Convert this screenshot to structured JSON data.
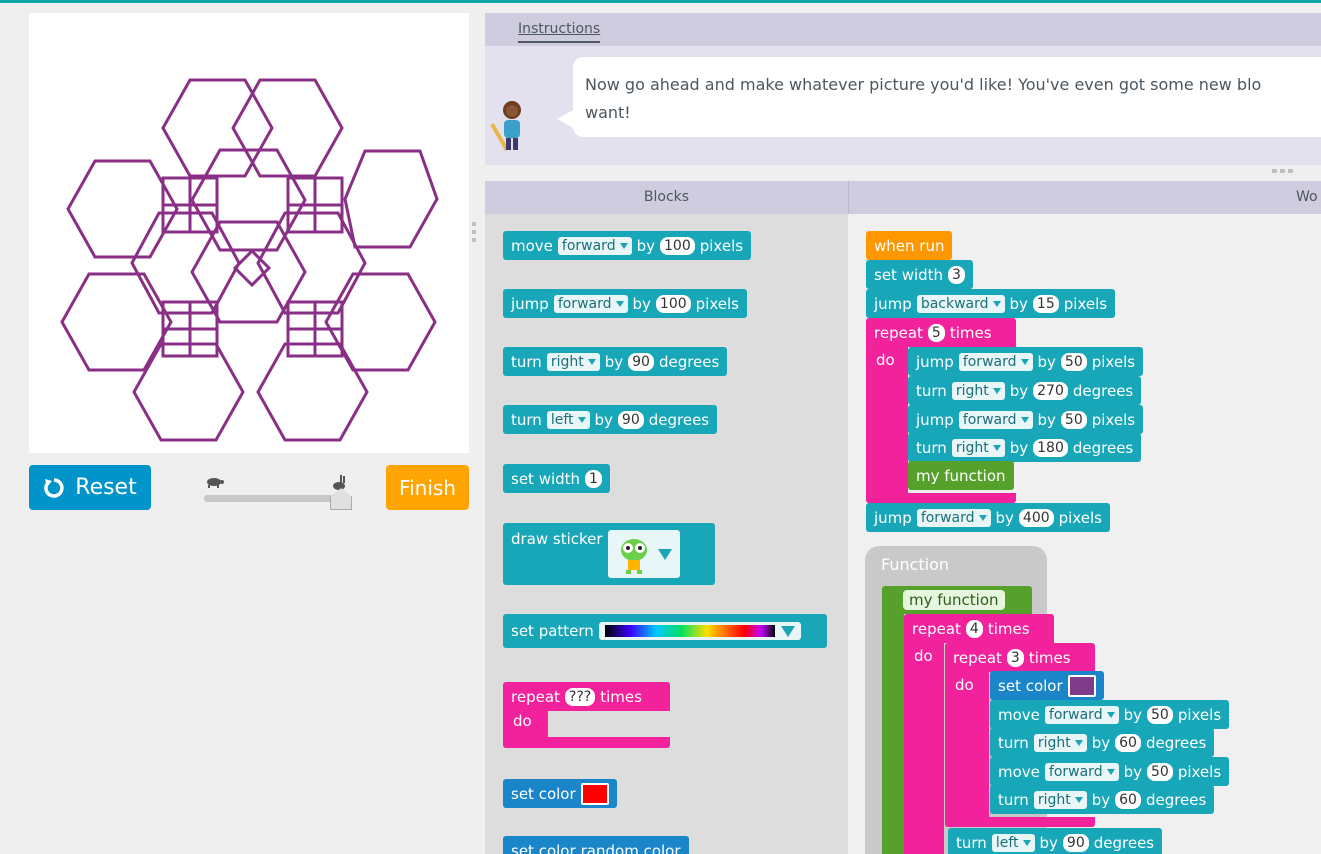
{
  "colors": {
    "teal": "#18a7b8",
    "pink": "#f2229c",
    "orange": "#ff9800",
    "green": "#56a12b",
    "blue": "#1a86c9",
    "drawing": "#8a2f86",
    "set_color_swatch": "#7f3a8a",
    "palette_red": "#ff0000"
  },
  "controls": {
    "reset_label": "Reset",
    "finish_label": "Finish",
    "reset_icon": "reset-icon",
    "slow_icon": "turtle-icon",
    "fast_icon": "rabbit-icon"
  },
  "instructions": {
    "tab_label": "Instructions",
    "text_line1": "Now go ahead and make whatever picture you'd like! You've even got some new blo",
    "text_line2": "want!"
  },
  "headers": {
    "toolbox": "Blocks",
    "workspace": "Wo"
  },
  "toolbox": {
    "move": {
      "verb": "move",
      "dir": "forward",
      "by": "by",
      "amount": "100",
      "unit": "pixels"
    },
    "jump": {
      "verb": "jump",
      "dir": "forward",
      "by": "by",
      "amount": "100",
      "unit": "pixels"
    },
    "turn_right": {
      "verb": "turn",
      "dir": "right",
      "by": "by",
      "amount": "90",
      "unit": "degrees"
    },
    "turn_left": {
      "verb": "turn",
      "dir": "left",
      "by": "by",
      "amount": "90",
      "unit": "degrees"
    },
    "set_width": {
      "label": "set width",
      "value": "1"
    },
    "draw_sticker": {
      "label": "draw sticker"
    },
    "set_pattern": {
      "label": "set pattern"
    },
    "repeat": {
      "label": "repeat",
      "count": "???",
      "times": "times",
      "do": "do"
    },
    "set_color": {
      "label": "set color"
    },
    "set_color_random": {
      "label": "set color",
      "value": "random color"
    }
  },
  "workspace": {
    "when_run": "when run",
    "set_width": {
      "label": "set width",
      "value": "3"
    },
    "jump_back": {
      "verb": "jump",
      "dir": "backward",
      "by": "by",
      "amount": "15",
      "unit": "pixels"
    },
    "repeat": {
      "label": "repeat",
      "count": "5",
      "times": "times",
      "do": "do"
    },
    "body": [
      {
        "verb": "jump",
        "dir": "forward",
        "by": "by",
        "amount": "50",
        "unit": "pixels"
      },
      {
        "verb": "turn",
        "dir": "right",
        "by": "by",
        "amount": "270",
        "unit": "degrees"
      },
      {
        "verb": "jump",
        "dir": "forward",
        "by": "by",
        "amount": "50",
        "unit": "pixels"
      },
      {
        "verb": "turn",
        "dir": "right",
        "by": "by",
        "amount": "180",
        "unit": "degrees"
      }
    ],
    "call": "my function",
    "jump_fwd": {
      "verb": "jump",
      "dir": "forward",
      "by": "by",
      "amount": "400",
      "unit": "pixels"
    },
    "function": {
      "title": "Function",
      "name": "my function",
      "repeat_outer": {
        "label": "repeat",
        "count": "4",
        "times": "times",
        "do": "do"
      },
      "repeat_inner": {
        "label": "repeat",
        "count": "3",
        "times": "times",
        "do": "do"
      },
      "set_color": "set color",
      "inner": [
        {
          "verb": "move",
          "dir": "forward",
          "by": "by",
          "amount": "50",
          "unit": "pixels"
        },
        {
          "verb": "turn",
          "dir": "right",
          "by": "by",
          "amount": "60",
          "unit": "degrees"
        },
        {
          "verb": "move",
          "dir": "forward",
          "by": "by",
          "amount": "50",
          "unit": "pixels"
        },
        {
          "verb": "turn",
          "dir": "right",
          "by": "by",
          "amount": "60",
          "unit": "degrees"
        }
      ],
      "turn_left": {
        "verb": "turn",
        "dir": "left",
        "by": "by",
        "amount": "90",
        "unit": "degrees"
      }
    }
  }
}
